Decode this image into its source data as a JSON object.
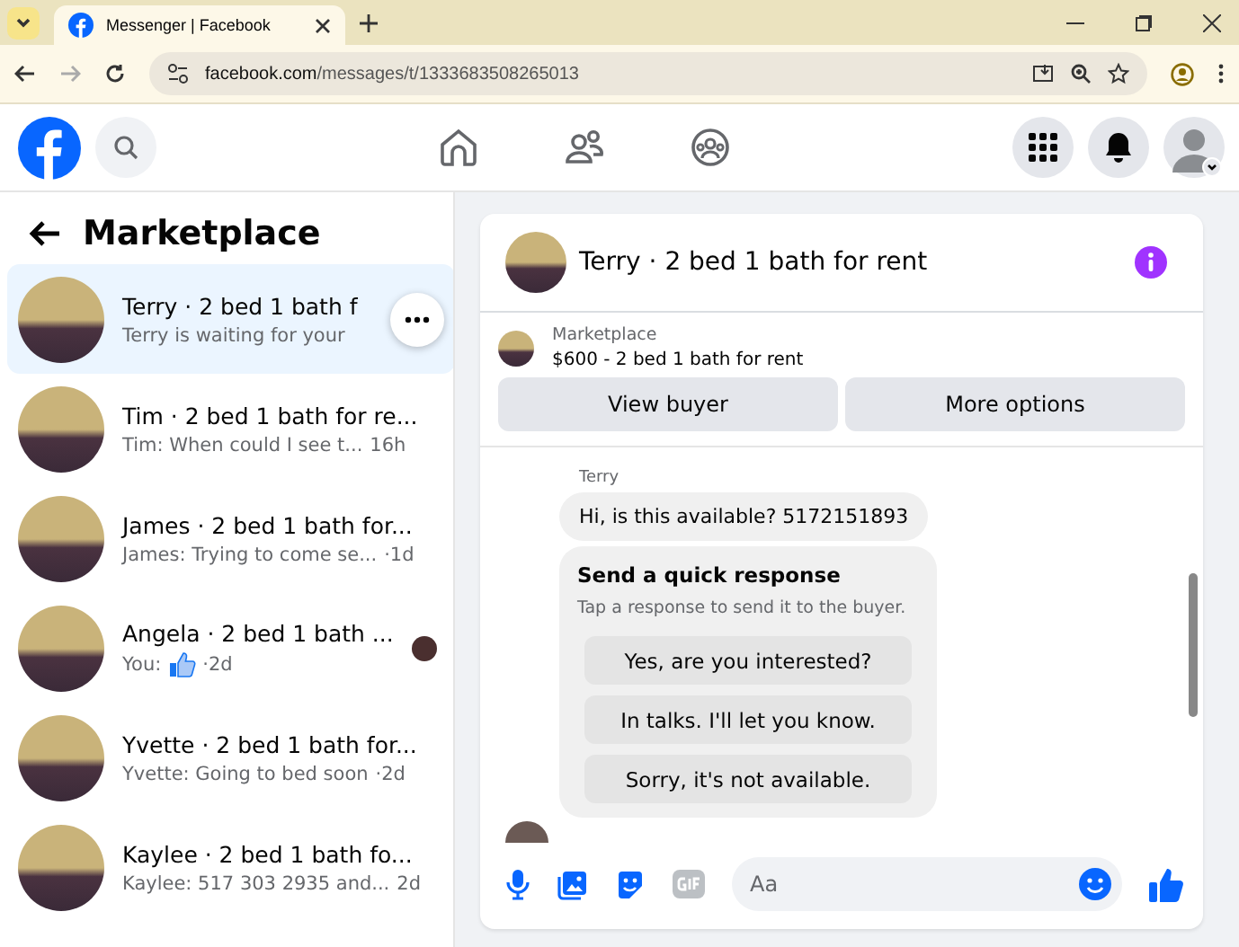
{
  "browser": {
    "tab_title": "Messenger | Facebook",
    "url_host": "facebook.com",
    "url_path": "/messages/t/1333683508265013"
  },
  "left": {
    "title": "Marketplace",
    "conversations": [
      {
        "title": "Terry · 2 bed 1 bath f",
        "preview": "Terry is waiting for your",
        "selected": true,
        "like": false,
        "seen_avatar": false,
        "menu": true
      },
      {
        "title": "Tim · 2 bed 1 bath for re...",
        "preview": "Tim: When could I see t...",
        "time": "16h",
        "selected": false,
        "like": false,
        "seen_avatar": false,
        "menu": false
      },
      {
        "title": "James · 2 bed 1 bath for...",
        "preview": "James: Trying to come se...",
        "time": "·1d",
        "selected": false,
        "like": false,
        "seen_avatar": false,
        "menu": false
      },
      {
        "title": "Angela · 2 bed 1 bath ...",
        "preview": "You:",
        "time": "·2d",
        "selected": false,
        "like": true,
        "seen_avatar": true,
        "menu": false
      },
      {
        "title": "Yvette · 2 bed 1 bath for...",
        "preview": "Yvette: Going to bed soon",
        "time": "·2d",
        "selected": false,
        "like": false,
        "seen_avatar": false,
        "menu": false
      },
      {
        "title": "Kaylee · 2 bed 1 bath fo...",
        "preview": "Kaylee: 517 303 2935 and...",
        "time": "2d",
        "selected": false,
        "like": false,
        "seen_avatar": false,
        "menu": false
      }
    ]
  },
  "chat": {
    "title": "Terry · 2 bed 1 bath for rent",
    "listing": {
      "source": "Marketplace",
      "description": "$600 - 2 bed 1 bath for rent"
    },
    "actions": [
      "View buyer",
      "More options"
    ],
    "sender": "Terry",
    "message": "Hi, is this available? 5172151893",
    "quick": {
      "title": "Send a quick response",
      "hint": "Tap a response to send it to the buyer.",
      "responses": [
        "Yes, are you interested?",
        "In talks. I'll let you know.",
        "Sorry, it's not available."
      ]
    },
    "composer": {
      "placeholder": "Aa"
    }
  }
}
